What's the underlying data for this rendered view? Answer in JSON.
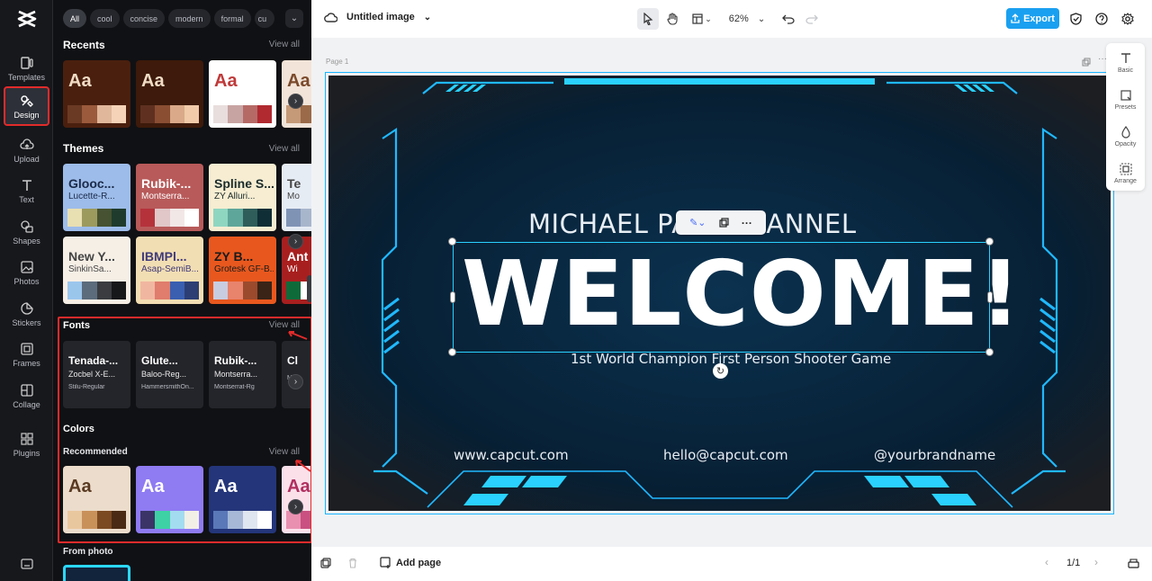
{
  "rail": {
    "items": [
      {
        "label": "Templates"
      },
      {
        "label": "Design"
      },
      {
        "label": "Upload"
      },
      {
        "label": "Text"
      },
      {
        "label": "Shapes"
      },
      {
        "label": "Photos"
      },
      {
        "label": "Stickers"
      },
      {
        "label": "Frames"
      },
      {
        "label": "Collage"
      },
      {
        "label": "Plugins"
      }
    ]
  },
  "panel": {
    "chips": [
      "All",
      "cool",
      "concise",
      "modern",
      "formal",
      "cu"
    ],
    "recents_title": "Recents",
    "themes_title": "Themes",
    "fonts_title": "Fonts",
    "colors_title": "Colors",
    "recommended_title": "Recommended",
    "from_photo_title": "From photo",
    "view_all": "View all",
    "aa": "Aa",
    "recents": [
      {
        "bg": "#4a1f0e",
        "fg": "#f1dcc5",
        "sw": [
          "#6b3a24",
          "#9b5a3c",
          "#e0b79a",
          "#f5d3b8"
        ]
      },
      {
        "bg": "#3d1a0b",
        "fg": "#f1dcc5",
        "sw": [
          "#5f3020",
          "#8a4e33",
          "#d9a989",
          "#f0caa9"
        ]
      },
      {
        "bg": "#ffffff",
        "fg": "#c03a3a",
        "sw": [
          "#e8dedd",
          "#c7a4a2",
          "#b56a66",
          "#b02a30"
        ]
      },
      {
        "bg": "#f2e4d8",
        "fg": "#7b4a2b",
        "sw": [
          "#c59a78",
          "#9b6a48",
          "#7b4a2b",
          "#5a3219"
        ]
      }
    ],
    "themes": [
      {
        "bg": "#9dbce9",
        "fg": "#1a2a4a",
        "t1": "Glooc...",
        "t2": "Lucette-R...",
        "sw": [
          "#e8dfb2",
          "#9c9a5d",
          "#465231",
          "#1f3b2d"
        ]
      },
      {
        "bg": "#b85a5a",
        "fg": "#ffffff",
        "t1": "Rubik-...",
        "t2": "Montserra...",
        "sw": [
          "#b5323b",
          "#e1c7c8",
          "#f2e7e7",
          "#ffffff"
        ]
      },
      {
        "bg": "#f6edd2",
        "fg": "#1b2b2b",
        "t1": "Spline S...",
        "t2": "ZY Alluri...",
        "sw": [
          "#8fd6c1",
          "#5fa69a",
          "#2f5d5a",
          "#0f2e35"
        ]
      },
      {
        "bg": "#e6ecf4",
        "fg": "#444",
        "t1": "Te",
        "t2": "Mo",
        "sw": [
          "#7f93b5",
          "#a8b6cc",
          "#d6dde8",
          "#fff"
        ]
      },
      {
        "bg": "#f6efe6",
        "fg": "#444",
        "t1": "New Y...",
        "t2": "SinkinSa...",
        "sw": [
          "#9bc6ec",
          "#5c6c7c",
          "#3a3c40",
          "#17181a"
        ]
      },
      {
        "bg": "#f2deb3",
        "fg": "#3f3a7a",
        "t1": "IBMPl...",
        "t2": "Asap-SemiB...",
        "sw": [
          "#f1b6a0",
          "#e07d6c",
          "#3a5fb0",
          "#2c3e74"
        ]
      },
      {
        "bg": "#e8581e",
        "fg": "#1a1a1a",
        "t1": "ZY B...",
        "t2": "Grotesk GF-B...",
        "sw": [
          "#c8cde0",
          "#e8836c",
          "#9b4a2d",
          "#3a2417"
        ]
      },
      {
        "bg": "#a81f1f",
        "fg": "#ffffff",
        "t1": "Ant",
        "t2": "Wi",
        "sw": [
          "#0f6a3a",
          "#fff",
          "#e8d9c0",
          "#c0a080"
        ]
      }
    ],
    "fonts": [
      {
        "f1": "Tenada-...",
        "f2": "Zocbel X-E...",
        "f3": "Stilu-Regular"
      },
      {
        "f1": "Glute...",
        "f2": "Baloo-Reg...",
        "f3": "HammersmithOn..."
      },
      {
        "f1": "Rubik-...",
        "f2": "Montserra...",
        "f3": "Montserrat-Rg"
      },
      {
        "f1": "Cl",
        "f2": "",
        "f3": "Mon"
      }
    ],
    "colors": [
      {
        "bg": "#ecdccb",
        "fg": "#5a3a22",
        "sw": [
          "#e9c79e",
          "#c8915a",
          "#7b4a22",
          "#4a2a14"
        ]
      },
      {
        "bg": "#8f7bf2",
        "fg": "#ffffff",
        "sw": [
          "#3a3566",
          "#3ed1a5",
          "#a3dcf0",
          "#f2efe6"
        ]
      },
      {
        "bg": "#24357a",
        "fg": "#ffffff",
        "sw": [
          "#5a78b8",
          "#a6b8d6",
          "#dfe6ef",
          "#ffffff"
        ]
      },
      {
        "bg": "#fbe0ea",
        "fg": "#b0305f",
        "sw": [
          "#e990b0",
          "#c95080",
          "#a03060",
          "#701840"
        ]
      }
    ]
  },
  "topbar": {
    "title": "Untitled image",
    "zoom": "62%",
    "export_label": "Export"
  },
  "canvas": {
    "page_label": "Page 1",
    "channel_line": "MICHAEL PA     N CHANNEL",
    "headline": "WELCOME!",
    "tagline": "1st World Champion First Person Shooter Game",
    "website": "www.capcut.com",
    "email": "hello@capcut.com",
    "handle": "@yourbrandname"
  },
  "right_tools": [
    {
      "label": "Basic"
    },
    {
      "label": "Presets"
    },
    {
      "label": "Opacity"
    },
    {
      "label": "Arrange"
    }
  ],
  "bottom": {
    "add_page": "Add page",
    "page_count": "1/1"
  }
}
